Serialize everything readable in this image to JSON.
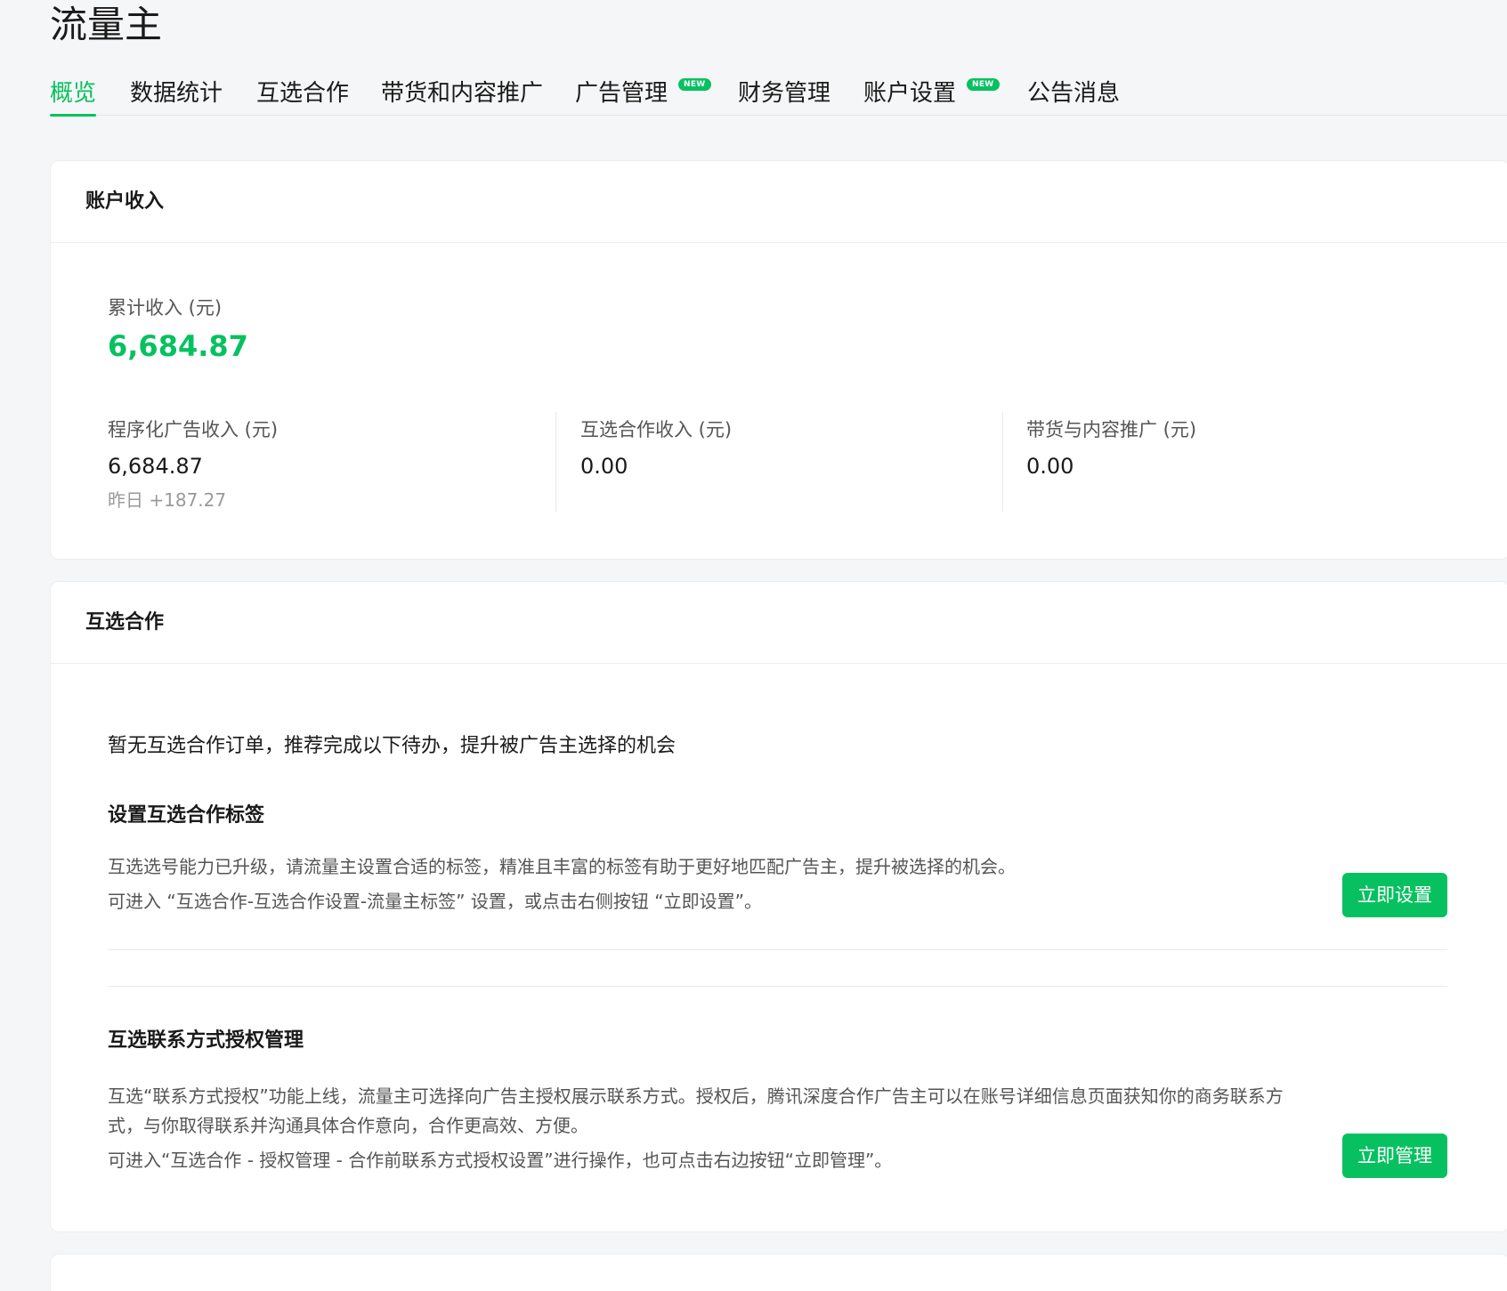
{
  "app": {
    "title": "流量主"
  },
  "tabs": [
    {
      "label": "概览",
      "active": true,
      "badge": ""
    },
    {
      "label": "数据统计",
      "active": false,
      "badge": ""
    },
    {
      "label": "互选合作",
      "active": false,
      "badge": ""
    },
    {
      "label": "带货和内容推广",
      "active": false,
      "badge": ""
    },
    {
      "label": "广告管理",
      "active": false,
      "badge": "NEW"
    },
    {
      "label": "财务管理",
      "active": false,
      "badge": ""
    },
    {
      "label": "账户设置",
      "active": false,
      "badge": "NEW"
    },
    {
      "label": "公告消息",
      "active": false,
      "badge": ""
    }
  ],
  "income": {
    "title": "账户收入",
    "total_label": "累计收入 (元)",
    "total_value": "6,684.87",
    "stats": [
      {
        "label": "程序化广告收入 (元)",
        "value": "6,684.87",
        "sub": "昨日 +187.27"
      },
      {
        "label": "互选合作收入 (元)",
        "value": "0.00"
      },
      {
        "label": "带货与内容推广 (元)",
        "value": "0.00"
      }
    ]
  },
  "coop": {
    "title": "互选合作",
    "intro": "暂无互选合作订单，推荐完成以下待办，提升被广告主选择的机会",
    "sections": [
      {
        "title": "设置互选合作标签",
        "desc_a": "互选选号能力已升级，请流量主设置合适的标签，精准且丰富的标签有助于更好地匹配广告主，提升被选择的机会。",
        "desc_b": "可进入 “互选合作-互选合作设置-流量主标签” 设置，或点击右侧按钮 “立即设置”。",
        "button": "立即设置"
      },
      {
        "title": "互选联系方式授权管理",
        "desc_a": "互选“联系方式授权”功能上线，流量主可选择向广告主授权展示联系方式。授权后，腾讯深度合作广告主可以在账号详细信息页面获知你的商务联系方式，与你取得联系并沟通具体合作意向，合作更高效、方便。",
        "desc_b": "可进入“互选合作 - 授权管理 - 合作前联系方式授权设置”进行操作，也可点击右边按钮“立即管理”。",
        "button": "立即管理"
      }
    ]
  },
  "colors": {
    "accent": "#07c160",
    "text": "#1a1a1a",
    "muted": "#555555",
    "background": "#f5f6f7"
  }
}
